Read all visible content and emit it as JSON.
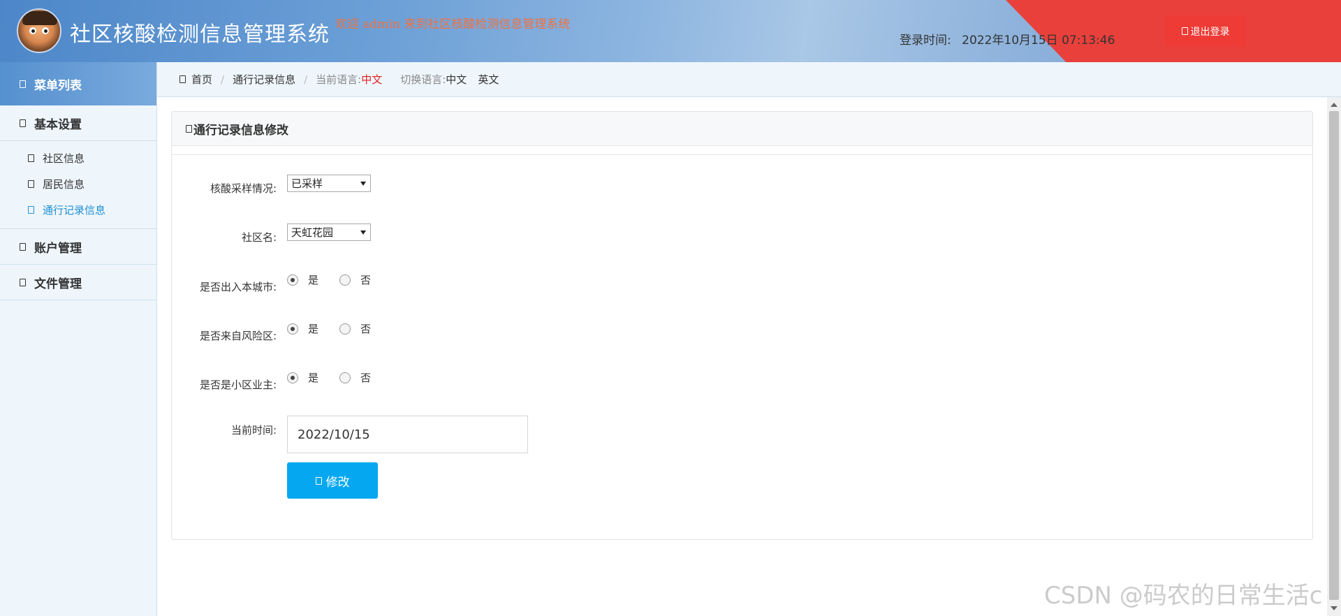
{
  "header": {
    "title": "社区核酸检测信息管理系统",
    "welcome": "欢迎  admin  来到社区核酸检测信息管理系统",
    "login_time_label": "登录时间:",
    "login_time_value": "2022年10月15日 07:13:46",
    "logout_label": "退出登录"
  },
  "sidebar": {
    "menu_head": "菜单列表",
    "groups": [
      {
        "label": "基本设置",
        "items": [
          {
            "label": "社区信息"
          },
          {
            "label": "居民信息"
          },
          {
            "label": "通行记录信息",
            "active": true
          }
        ]
      },
      {
        "label": "账户管理"
      },
      {
        "label": "文件管理"
      }
    ]
  },
  "breadcrumb": {
    "home": "首页",
    "current_page": "通行记录信息",
    "current_lang_label": "当前语言:",
    "current_lang_value": "中文",
    "switch_lang_label": "切换语言:",
    "lang_options": [
      "中文",
      "英文"
    ]
  },
  "form": {
    "panel_title": "通行记录信息修改",
    "fields": {
      "test_status": {
        "label": "核酸采样情况:",
        "value": "已采样"
      },
      "community": {
        "label": "社区名:",
        "value": "天虹花园"
      },
      "leave_city": {
        "label": "是否出入本城市:",
        "options": [
          "是",
          "否"
        ],
        "selected": "是"
      },
      "risk_area": {
        "label": "是否来自风险区:",
        "options": [
          "是",
          "否"
        ],
        "selected": "是"
      },
      "owner": {
        "label": "是否是小区业主:",
        "options": [
          "是",
          "否"
        ],
        "selected": "是"
      },
      "current_time": {
        "label": "当前时间:",
        "value": "2022/10/15"
      }
    },
    "submit_label": "修改"
  },
  "watermark": "CSDN @码农的日常生活c",
  "colors": {
    "header_blue": "#5a92d0",
    "logout_red": "#ee3b36",
    "accent_blue": "#05a8f0",
    "active_link": "#1f8fd6",
    "lang_red": "#e02020"
  }
}
